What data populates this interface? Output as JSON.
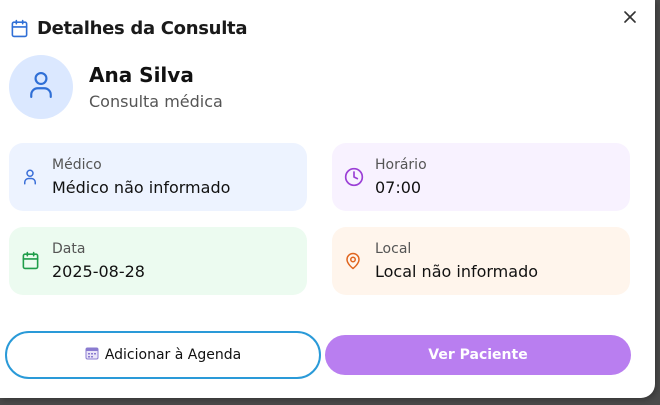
{
  "modal": {
    "title": "Detalhes da Consulta",
    "close_label": "×"
  },
  "patient": {
    "name": "Ana Silva",
    "subtitle": "Consulta médica"
  },
  "cards": {
    "medico": {
      "label": "Médico",
      "value": "Médico não informado",
      "icon": "user-icon",
      "color": "#3b6fd8"
    },
    "horario": {
      "label": "Horário",
      "value": "07:00",
      "icon": "clock-icon",
      "color": "#9b3fd6"
    },
    "data": {
      "label": "Data",
      "value": "2025-08-28",
      "icon": "calendar-icon",
      "color": "#1f9d4a"
    },
    "local": {
      "label": "Local",
      "value": "Local não informado",
      "icon": "map-pin-icon",
      "color": "#e0651f"
    }
  },
  "actions": {
    "add_to_calendar_label": "Adicionar à Agenda",
    "view_patient_label": "Ver Paciente"
  },
  "colors": {
    "accent_blue": "#2a9ad8",
    "primary_purple": "#b97ef0",
    "header_icon": "#2f6fd6"
  }
}
